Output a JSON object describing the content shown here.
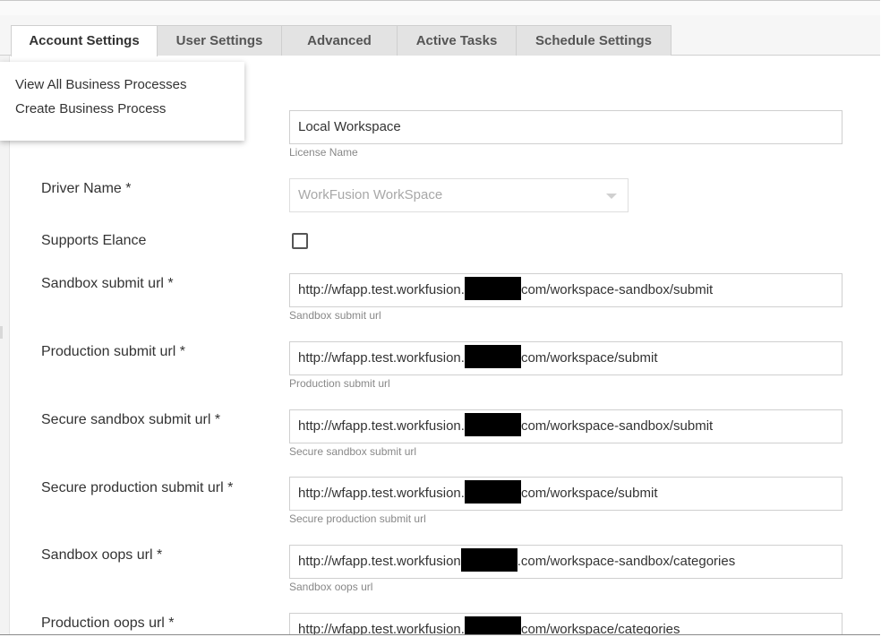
{
  "tabs": [
    {
      "label": "Account Settings",
      "active": true
    },
    {
      "label": "User Settings",
      "active": false
    },
    {
      "label": "Advanced",
      "active": false
    },
    {
      "label": "Active Tasks",
      "active": false
    },
    {
      "label": "Schedule Settings",
      "active": false
    }
  ],
  "dropdown_menu": {
    "items": [
      "View All Business Processes",
      "Create Business Process"
    ]
  },
  "form": {
    "license_name": {
      "value": "Local Workspace",
      "helper": "License Name"
    },
    "driver_name": {
      "label": "Driver Name *",
      "value": "WorkFusion WorkSpace"
    },
    "supports_elance": {
      "label": "Supports Elance",
      "checked": false
    },
    "sandbox_submit_url": {
      "label": "Sandbox submit url *",
      "value_prefix": "http://wfapp.test.workfusion.",
      "value_suffix": "com/workspace-sandbox/submit",
      "helper": "Sandbox submit url"
    },
    "production_submit_url": {
      "label": "Production submit url *",
      "value_prefix": "http://wfapp.test.workfusion.",
      "value_suffix": "com/workspace/submit",
      "helper": "Production submit url"
    },
    "secure_sandbox_submit_url": {
      "label": "Secure sandbox submit url *",
      "value_prefix": "http://wfapp.test.workfusion.",
      "value_suffix": "com/workspace-sandbox/submit",
      "helper": "Secure sandbox submit url"
    },
    "secure_production_submit_url": {
      "label": "Secure production submit url *",
      "value_prefix": "http://wfapp.test.workfusion.",
      "value_suffix": "com/workspace/submit",
      "helper": "Secure production submit url"
    },
    "sandbox_oops_url": {
      "label": "Sandbox oops url *",
      "value_prefix": "http://wfapp.test.workfusion",
      "value_suffix": ".com/workspace-sandbox/categories",
      "helper": "Sandbox oops url"
    },
    "production_oops_url": {
      "label": "Production oops url *",
      "value_prefix": "http://wfapp.test.workfusion.",
      "value_suffix": "com/workspace/categories"
    }
  }
}
